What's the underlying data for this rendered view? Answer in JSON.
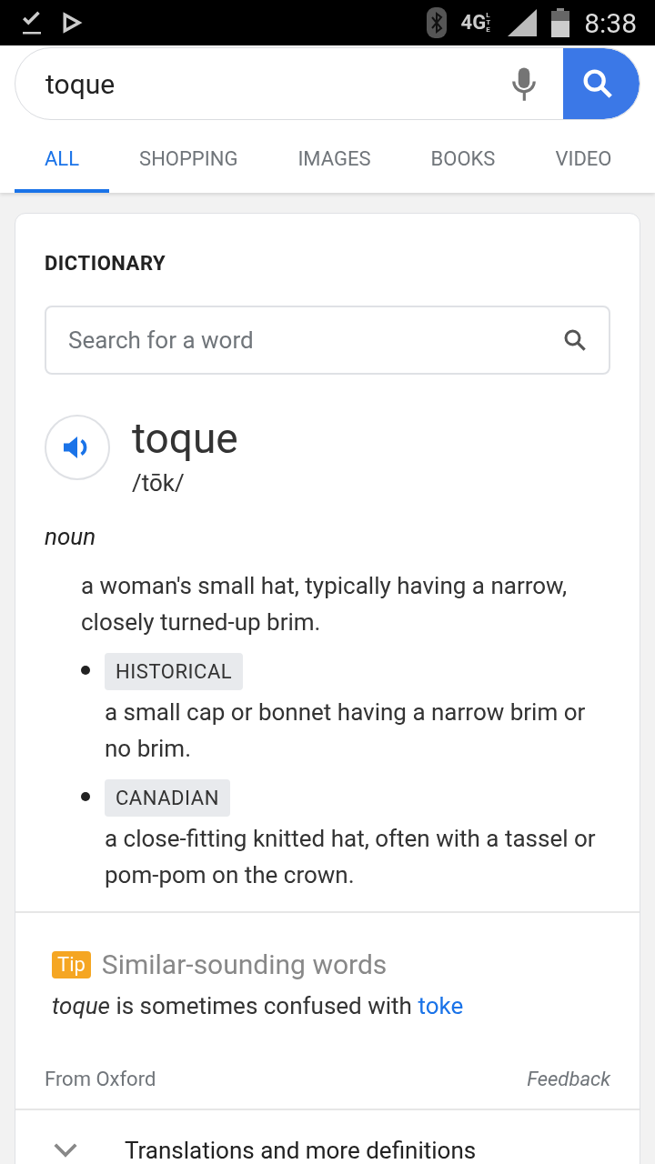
{
  "status_bar": {
    "network": "4G",
    "network_sub": "LTE",
    "time": "8:38"
  },
  "search": {
    "value": "toque"
  },
  "tabs": [
    {
      "label": "ALL",
      "selected": true
    },
    {
      "label": "SHOPPING",
      "selected": false
    },
    {
      "label": "IMAGES",
      "selected": false
    },
    {
      "label": "BOOKS",
      "selected": false
    },
    {
      "label": "VIDEO",
      "selected": false
    }
  ],
  "card": {
    "heading": "DICTIONARY",
    "word_search": {
      "placeholder": "Search for a word"
    },
    "word": "toque",
    "pronunciation": "/tōk/",
    "part_of_speech": "noun",
    "definition": "a woman's small hat, typically having a narrow, closely turned-up brim.",
    "senses": [
      {
        "tag": "HISTORICAL",
        "text": "a small cap or bonnet having a narrow brim or no brim."
      },
      {
        "tag": "CANADIAN",
        "text": "a close-fitting knitted hat, often with a tassel or pom-pom on the crown."
      }
    ],
    "tip": {
      "badge": "Tip",
      "title": "Similar-sounding words",
      "sentence": "*toque* is sometimes confused with",
      "link": "toke"
    },
    "source": "From Oxford",
    "feedback": "Feedback",
    "more": {
      "label": "Translations and more definitions",
      "expanded": false
    }
  }
}
